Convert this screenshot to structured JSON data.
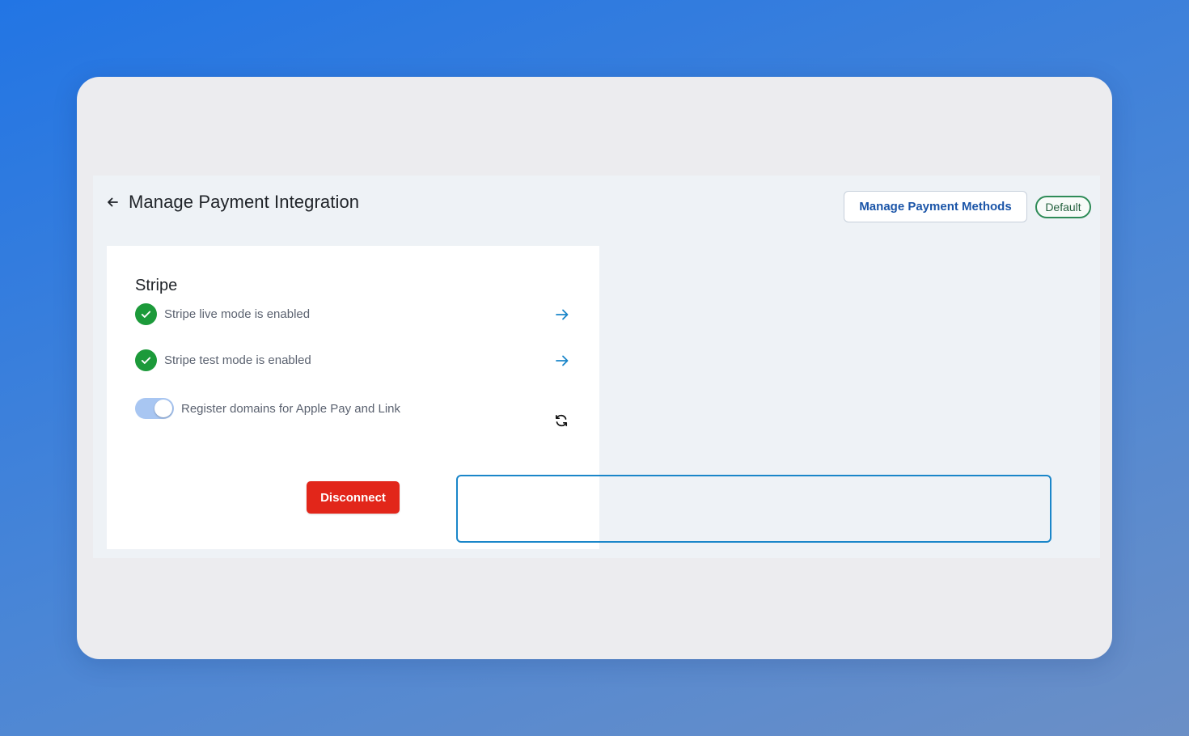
{
  "header": {
    "title": "Manage Payment Integration",
    "manage_methods_label": "Manage Payment Methods",
    "default_badge": "Default"
  },
  "card": {
    "title": "Stripe",
    "live_mode_label": "Stripe live mode is enabled",
    "test_mode_label": "Stripe test mode is enabled",
    "register_domains_label": "Register domains for Apple Pay and Link",
    "register_domains_on": true,
    "disconnect_label": "Disconnect"
  },
  "colors": {
    "accent_blue": "#1b55a8",
    "success_green": "#1c9a3a",
    "danger_red": "#e2261a",
    "highlight_border": "#1a86c9",
    "toggle_track": "#a8c6f2"
  },
  "icons": {
    "back": "arrow-left-icon",
    "status": "check-circle-icon",
    "navigate": "arrow-right-icon",
    "refresh": "refresh-icon"
  }
}
